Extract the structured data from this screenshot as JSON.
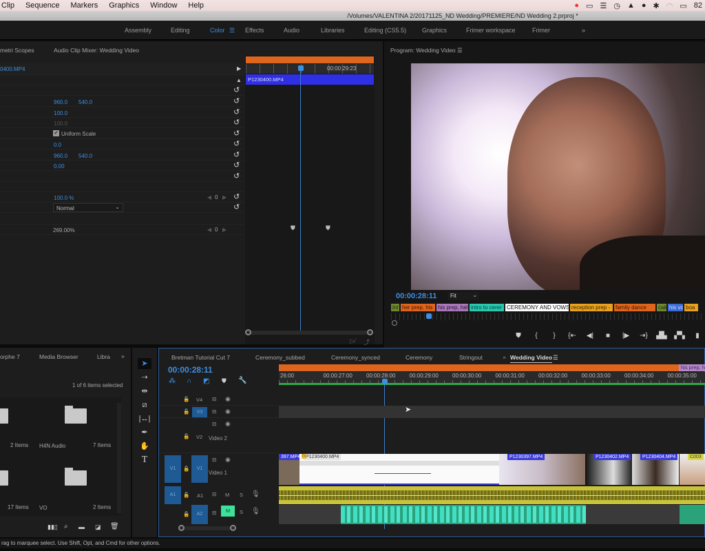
{
  "menubar": {
    "items": [
      "Clip",
      "Sequence",
      "Markers",
      "Graphics",
      "Window",
      "Help"
    ],
    "battery": "82"
  },
  "titlebar": {
    "path": "/Volumes/VALENTINA 2/20171125_ND Wedding/PREMIERE/ND Wedding 2.prproj *"
  },
  "workspaces": {
    "items": [
      "Assembly",
      "Editing",
      "Color",
      "Effects",
      "Audio",
      "Libraries",
      "Editing (CS5.5)",
      "Graphics",
      "Frimer workspace",
      "Frimer"
    ],
    "active": "Color",
    "more": "»"
  },
  "effect_controls": {
    "tabs": [
      "metri Scopes",
      "Audio Clip Mixer: Wedding Video"
    ],
    "clip": "0400.MP4",
    "position": [
      "960.0",
      "540.0"
    ],
    "scale": "100.0",
    "scale_width": "100.0",
    "uniform_scale": "Uniform Scale",
    "rotation": "0.0",
    "anchor": [
      "960.0",
      "540.0"
    ],
    "anti_flicker": "0.00",
    "opacity": "100.0 %",
    "blend_mode": "Normal",
    "time_remap": "269.00%",
    "keyframe_nav": "0",
    "mini_timeline": {
      "clip": "P1230400.MP4",
      "timecode": "00:00:29:23"
    }
  },
  "program_monitor": {
    "title": "Program: Wedding Video",
    "timecode": "00:00:28:11",
    "fit": "Fit",
    "markers": [
      {
        "label": "int",
        "color": "#6e8a2c",
        "text": "#222"
      },
      {
        "label": "her prep, his",
        "color": "#e0651c",
        "text": "#3a1500"
      },
      {
        "label": "his prep, hel",
        "color": "#a879b8",
        "text": "#2a0f3a"
      },
      {
        "label": "intro to cerer",
        "color": "#29c9b0",
        "text": "#053a33"
      },
      {
        "label": "CEREMONY AND VOWS",
        "color": "#ffffff",
        "text": "#111"
      },
      {
        "label": "reception prep -",
        "color": "#e8a21f",
        "text": "#3a2500"
      },
      {
        "label": "family dance",
        "color": "#e0651c",
        "text": "#3a1500"
      },
      {
        "label": "cak",
        "color": "#6e8a2c",
        "text": "#222"
      },
      {
        "label": "his vo",
        "color": "#3b6bd6",
        "text": "#dde"
      },
      {
        "label": "boa",
        "color": "#e8a21f",
        "text": "#3a2500"
      }
    ],
    "transport": [
      "marker",
      "mark-in",
      "mark-out",
      "go-to-in",
      "step-back",
      "stop",
      "step-forward",
      "go-to-out",
      "lift",
      "extract",
      "export"
    ]
  },
  "project": {
    "tabs": [
      "orphe 7",
      "Media Browser",
      "Libra"
    ],
    "more": "»",
    "selection": "1 of 6 items selected",
    "bins": [
      {
        "name": "",
        "count": "2 Items"
      },
      {
        "name": "H4N Audio",
        "count": "7 Items"
      },
      {
        "name": "",
        "count": "17 Items"
      },
      {
        "name": "VO",
        "count": "2 Items"
      }
    ]
  },
  "tools": [
    "selection",
    "track-select",
    "ripple-edit",
    "razor",
    "slip",
    "pen",
    "hand",
    "type"
  ],
  "timeline": {
    "tabs": [
      "Bretman Tutorial Cut 7",
      "Ceremony_subbed",
      "Ceremony_synced",
      "Ceremony",
      "Stringout",
      "Wedding Video"
    ],
    "active_tab": "Wedding Video",
    "timecode": "00:00:28:11",
    "ruler": [
      "26:00",
      "00:00:27:00",
      "00:00:28:00",
      "00:00:29:00",
      "00:00:30:00",
      "00:00:31:00",
      "00:00:32:00",
      "00:00:33:00",
      "00:00:34:00",
      "00:00:35:00"
    ],
    "marker_right": "his prep, h",
    "tracks": {
      "v4": "V4",
      "v3": "V3",
      "v2": "V2",
      "v2_name": "Video 2",
      "v1": "V1",
      "v1_name": "Video 1",
      "a1": "A1",
      "a2": "A2",
      "m": "M",
      "s": "S"
    },
    "clips": [
      "397.MP4",
      "P1230400.MP4",
      "P1230397.MP4",
      "P1230402.MP4",
      "P1230404.MP4",
      "C003"
    ]
  },
  "status": "rag to marquee select. Use Shift, Opt, and Cmd for other options."
}
